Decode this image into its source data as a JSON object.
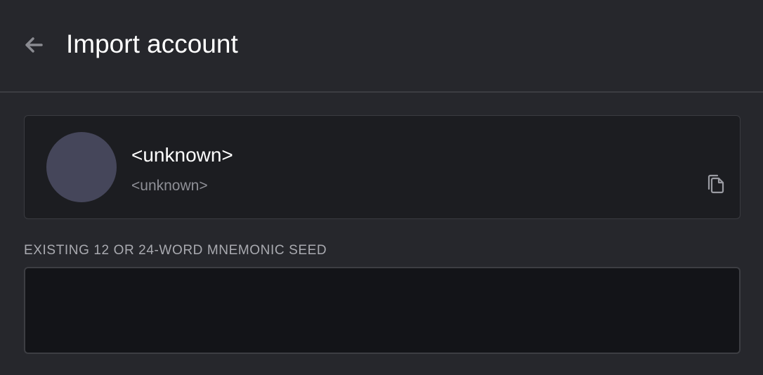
{
  "header": {
    "back_icon": "arrow-left-icon",
    "title": "Import account"
  },
  "account": {
    "name": "<unknown>",
    "address": "<unknown>",
    "avatar_color": "#45465a",
    "copy_icon": "copy-icon"
  },
  "seed": {
    "label": "EXISTING 12 OR 24-WORD MNEMONIC SEED",
    "value": "",
    "placeholder": ""
  },
  "colors": {
    "background": "#26272c",
    "card_background": "#1c1d21",
    "input_background": "#131418",
    "text_primary": "#ffffff",
    "text_secondary": "#8e8f96"
  }
}
